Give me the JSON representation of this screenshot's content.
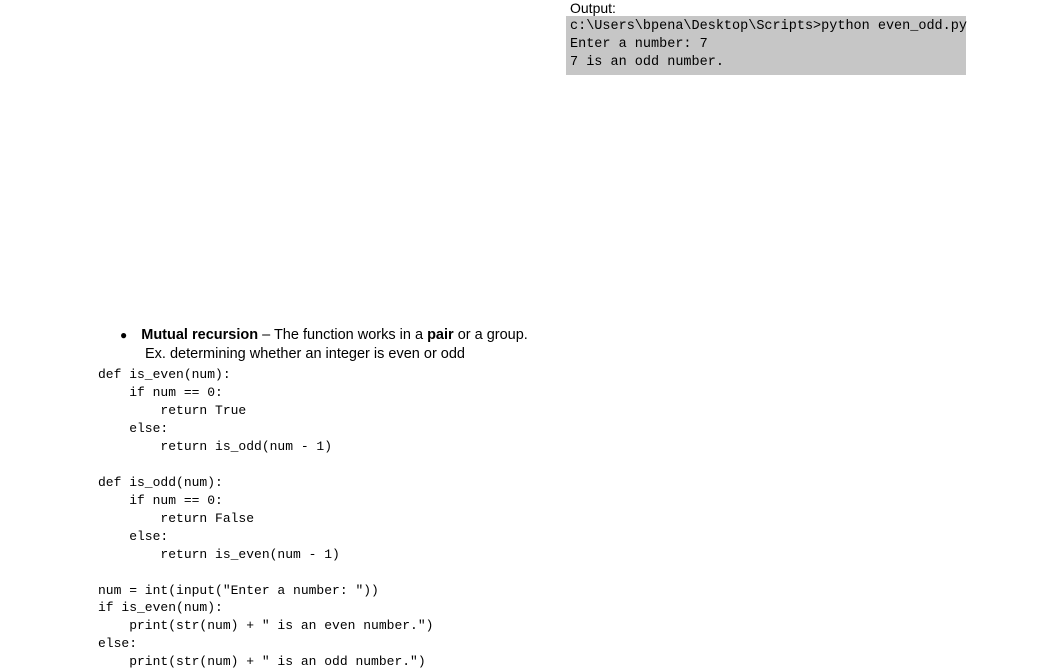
{
  "output": {
    "label": "Output:",
    "lines": [
      "c:\\Users\\bpena\\Desktop\\Scripts>python even_odd.py",
      "Enter a number: 7",
      "7 is an odd number."
    ]
  },
  "bullet": {
    "term": "Mutual recursion",
    "dash": " – ",
    "definition_part1": "The function works in a ",
    "pair": "pair",
    "definition_part2": " or a group."
  },
  "example": "Ex. determining whether an integer is even or odd",
  "code": "def is_even(num):\n    if num == 0:\n        return True\n    else:\n        return is_odd(num - 1)\n\ndef is_odd(num):\n    if num == 0:\n        return False\n    else:\n        return is_even(num - 1)\n\nnum = int(input(\"Enter a number: \"))\nif is_even(num):\n    print(str(num) + \" is an even number.\")\nelse:\n    print(str(num) + \" is an odd number.\")"
}
